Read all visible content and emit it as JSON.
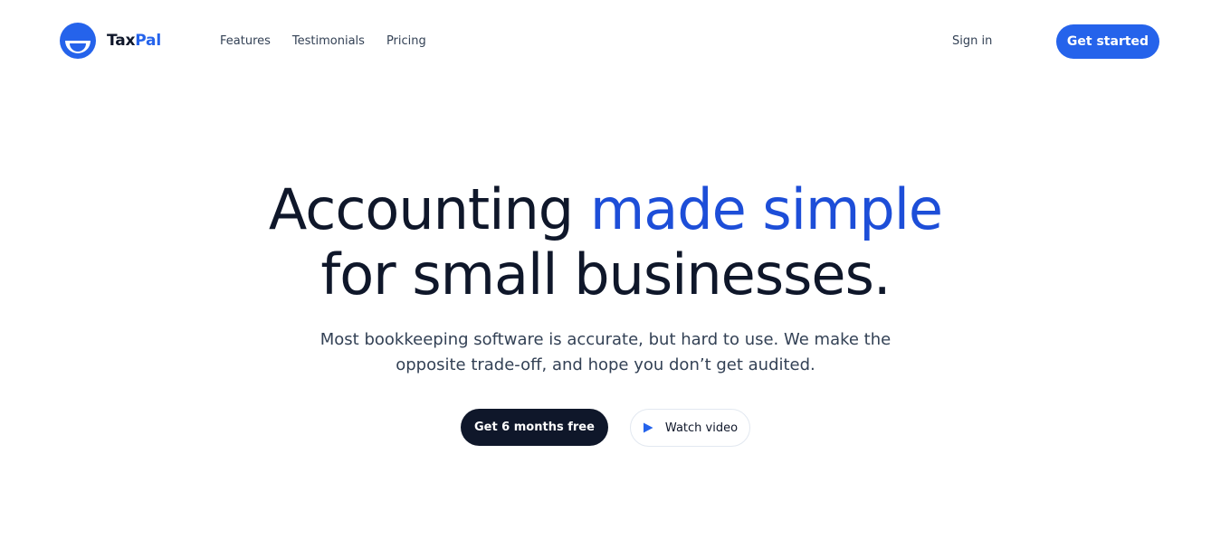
{
  "brand": {
    "name_part1": "Tax",
    "name_part2": "Pal",
    "accent_color": "#2563eb"
  },
  "nav": {
    "items": [
      {
        "label": "Features"
      },
      {
        "label": "Testimonials"
      },
      {
        "label": "Pricing"
      }
    ]
  },
  "header": {
    "signin_label": "Sign in",
    "cta_label": "Get started"
  },
  "hero": {
    "title_part1": "Accounting ",
    "title_highlight": "made simple",
    "title_part2": "for small businesses.",
    "subtitle": "Most bookkeeping software is accurate, but hard to use. We make the opposite trade-off, and hope you don’t get audited."
  },
  "actions": {
    "primary_label": "Get 6 months free",
    "secondary_label": "Watch video",
    "secondary_icon": "play-icon"
  }
}
